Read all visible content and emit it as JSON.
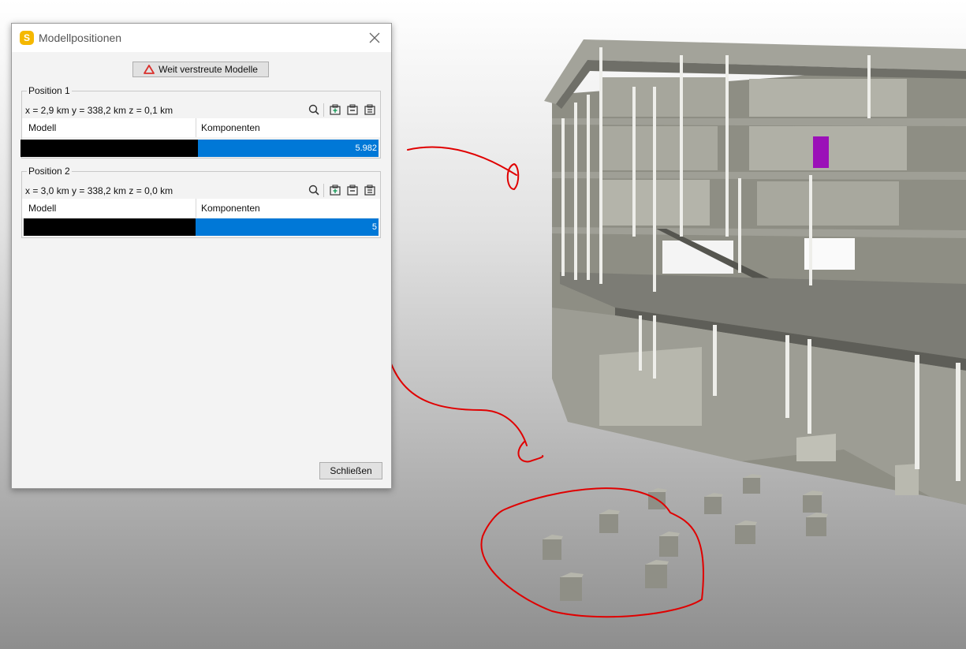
{
  "dialog": {
    "title": "Modellpositionen",
    "app_icon_letter": "S",
    "scatter_button_label": "Weit verstreute Modelle",
    "close_button_label": "Schließen",
    "groups": [
      {
        "legend": "Position 1",
        "coords": "x = 2,9 km y = 338,2 km z = 0,1 km",
        "columns": [
          "Modell",
          "Komponenten"
        ],
        "rows": [
          {
            "model": "",
            "components": "5.982"
          }
        ]
      },
      {
        "legend": "Position 2",
        "coords": "x = 3,0 km y = 338,2 km z = 0,0 km",
        "columns": [
          "Modell",
          "Komponenten"
        ],
        "rows": [
          {
            "model": "",
            "components": "5"
          }
        ]
      }
    ],
    "tools": [
      "search-icon",
      "add-model-icon",
      "remove-model-icon",
      "list-model-icon"
    ]
  },
  "colors": {
    "selection": "#0078d7",
    "warning": "#d9302c",
    "annotation": "#e00000",
    "highlight": "#9b10b8",
    "app_icon": "#f5b800"
  }
}
